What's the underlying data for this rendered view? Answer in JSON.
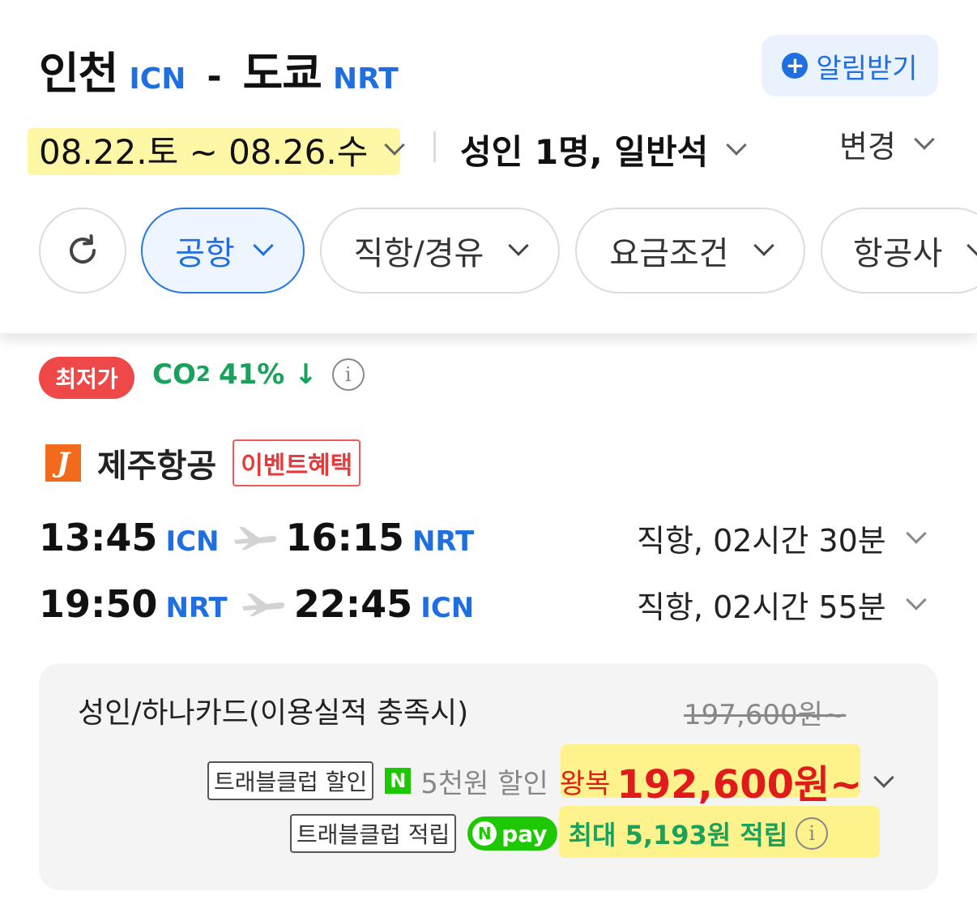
{
  "header": {
    "origin_city": "인천",
    "origin_code": "ICN",
    "separator": "-",
    "dest_city": "도쿄",
    "dest_code": "NRT",
    "alert_plus": "+",
    "alert_label": "알림받기",
    "dates": "08.22.토 ~ 08.26.수",
    "passengers": "성인 1명, 일반석",
    "change_label": "변경"
  },
  "filters": {
    "items": [
      {
        "label": "공항",
        "active": true
      },
      {
        "label": "직항/경유",
        "active": false
      },
      {
        "label": "요금조건",
        "active": false
      },
      {
        "label": "항공사",
        "active": false
      }
    ]
  },
  "result": {
    "badge": "최저가",
    "co2_prefix": "CO",
    "co2_sub": "2",
    "co2_value": "41% ↓",
    "info_glyph": "i",
    "airline_logo": "J",
    "airline_name": "제주항공",
    "event_tag": "이벤트혜택",
    "legs": [
      {
        "dep_time": "13:45",
        "dep_code": "ICN",
        "arr_time": "16:15",
        "arr_code": "NRT",
        "info": "직항, 02시간 30분"
      },
      {
        "dep_time": "19:50",
        "dep_code": "NRT",
        "arr_time": "22:45",
        "arr_code": "ICN",
        "info": "직항, 02시간 55분"
      }
    ],
    "price_box": {
      "label": "성인/하나카드(이용실적 충족시)",
      "original_price": "197,600원~",
      "travelclub_discount_tag": "트래블클럽 할인",
      "naver_logo": "N",
      "discount_text": "5천원 할인",
      "roundtrip_label": "왕복",
      "price": "192,600원~",
      "travelclub_points_tag": "트래블클럽 적립",
      "npay_n": "N",
      "npay_label": "pay",
      "points_text": "최대 5,193원 적립"
    }
  },
  "colors": {
    "accent_blue": "#1f6fe0",
    "price_red": "#e11b1b",
    "eco_green": "#1aa15b",
    "badge_red": "#ef4848",
    "highlight_yellow": "#fdf28c",
    "airline_orange": "#f26a1b",
    "naver_green": "#1ec800"
  },
  "icons": {
    "refresh": "refresh-icon",
    "plane": "plane-icon",
    "chevron": "chevron-down-icon",
    "info": "info-icon",
    "plus": "plus-icon"
  }
}
